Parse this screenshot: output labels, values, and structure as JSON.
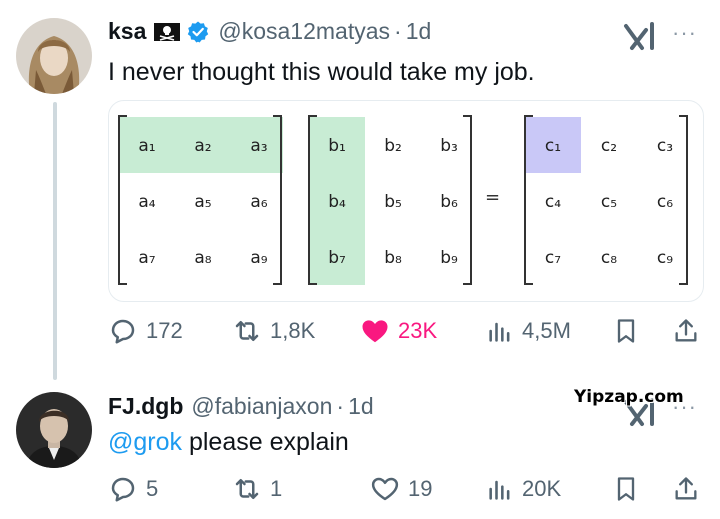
{
  "tweet1": {
    "name": "ksa",
    "handle": "@kosa12matyas",
    "dot": "·",
    "time": "1d",
    "text": "I never thought this would take my job.",
    "icons": [
      "pirate-flag-icon",
      "verified-icon",
      "grok-icon",
      "more-icon"
    ],
    "actions": {
      "replies": "172",
      "reposts": "1,8K",
      "likes": "23K",
      "views": "4,5M"
    },
    "matrix": {
      "a": [
        [
          "a₁",
          "a₂",
          "a₃"
        ],
        [
          "a₄",
          "a₅",
          "a₆"
        ],
        [
          "a₇",
          "a₈",
          "a₉"
        ]
      ],
      "b": [
        [
          "b₁",
          "b₂",
          "b₃"
        ],
        [
          "b₄",
          "b₅",
          "b₆"
        ],
        [
          "b₇",
          "b₈",
          "b₉"
        ]
      ],
      "equals": "=",
      "c": [
        [
          "c₁",
          "c₂",
          "c₃"
        ],
        [
          "c₄",
          "c₅",
          "c₆"
        ],
        [
          "c₇",
          "c₈",
          "c₉"
        ]
      ],
      "highlight_green": "#c8ecd4",
      "highlight_purple": "#c9c8f7"
    }
  },
  "tweet2": {
    "name": "FJ.dgb",
    "handle": "@fabianjaxon",
    "dot": "·",
    "time": "1d",
    "mention": "@grok",
    "text": " please explain",
    "actions": {
      "replies": "5",
      "reposts": "1",
      "likes": "19",
      "views": "20K"
    }
  },
  "watermark": "Yipzap.com",
  "colors": {
    "text": "#0f1419",
    "secondary": "#536471",
    "link": "#1d9bf0",
    "like": "#f91880",
    "verified": "#1d9bf0",
    "thread_line": "#cfd9de"
  }
}
